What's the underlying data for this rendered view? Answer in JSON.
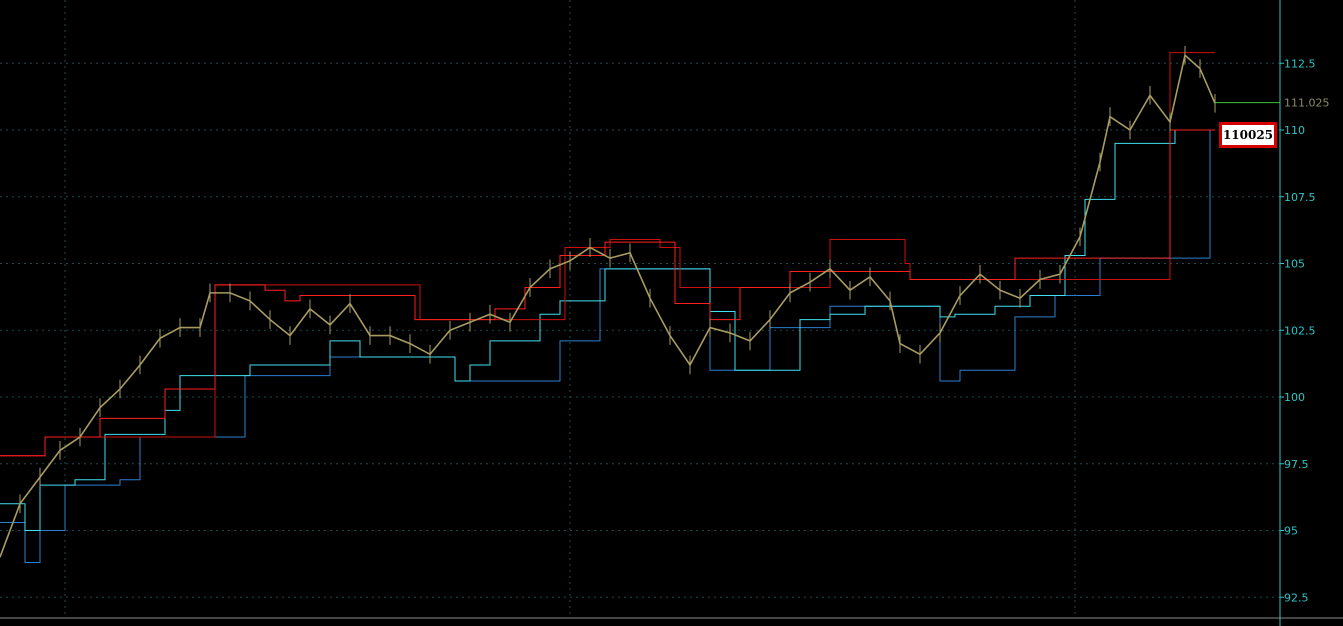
{
  "colors": {
    "background": "#000000",
    "grid": "#1f4a4a",
    "axis": "#2ec4c4",
    "tick_text": "#2ec4c4",
    "price": "#a89c62",
    "channel_upper_fast": "#ff2020",
    "channel_upper_slow": "#cc1010",
    "channel_lower_fast": "#40e0f0",
    "channel_lower_slow": "#2a7fd0",
    "last_price_line": "#3cc43c",
    "last_price_text": "#8a8a66"
  },
  "chart_data": {
    "type": "line",
    "ylim": [
      92.0,
      113.5
    ],
    "xlim": [
      0,
      1215
    ],
    "y_ticks": [
      "92.5",
      "95",
      "97.5",
      "100",
      "102.5",
      "105",
      "107.5",
      "110",
      "112.5"
    ],
    "grid": true,
    "last_price_label": "111.025",
    "price_box_label": "110025",
    "series": [
      {
        "role": "price",
        "x": [
          0,
          20,
          40,
          60,
          80,
          100,
          120,
          140,
          160,
          180,
          200,
          210,
          230,
          250,
          270,
          290,
          310,
          330,
          350,
          370,
          390,
          410,
          430,
          450,
          470,
          490,
          510,
          530,
          550,
          570,
          590,
          610,
          630,
          650,
          670,
          690,
          710,
          730,
          750,
          770,
          790,
          810,
          830,
          850,
          870,
          890,
          900,
          920,
          940,
          960,
          980,
          1000,
          1020,
          1040,
          1060,
          1080,
          1100,
          1110,
          1130,
          1150,
          1170,
          1185,
          1200,
          1215
        ],
        "y": [
          94.0,
          96.0,
          97.0,
          98.0,
          98.5,
          99.6,
          100.3,
          101.2,
          102.2,
          102.6,
          102.6,
          103.9,
          103.9,
          103.6,
          102.9,
          102.3,
          103.3,
          102.7,
          103.5,
          102.3,
          102.3,
          102.0,
          101.6,
          102.5,
          102.8,
          103.1,
          102.8,
          104.1,
          104.8,
          105.1,
          105.6,
          105.2,
          105.4,
          103.7,
          102.3,
          101.2,
          102.6,
          102.4,
          102.1,
          102.9,
          103.9,
          104.3,
          104.8,
          104.0,
          104.5,
          103.6,
          102.0,
          101.6,
          102.4,
          103.8,
          104.6,
          104.0,
          103.7,
          104.4,
          104.6,
          106.0,
          108.8,
          110.5,
          110.0,
          111.3,
          110.3,
          112.8,
          112.3,
          111.0
        ]
      },
      {
        "role": "channel-upper-fast",
        "x": [
          0,
          45,
          45,
          100,
          100,
          165,
          165,
          215,
          215,
          265,
          265,
          285,
          285,
          300,
          300,
          340,
          340,
          415,
          415,
          495,
          495,
          525,
          525,
          560,
          560,
          605,
          605,
          675,
          675,
          710,
          710,
          740,
          740,
          790,
          790,
          830,
          830,
          905,
          905,
          910,
          910,
          990,
          990,
          1015,
          1015,
          1060,
          1060,
          1100,
          1100,
          1140,
          1140,
          1170,
          1170,
          1215
        ],
        "y": [
          97.8,
          97.8,
          98.5,
          98.5,
          99.2,
          99.2,
          100.3,
          100.3,
          104.2,
          104.2,
          104.0,
          104.0,
          103.6,
          103.6,
          103.8,
          103.8,
          103.8,
          103.8,
          102.9,
          102.9,
          103.3,
          103.3,
          104.1,
          104.1,
          105.3,
          105.3,
          105.8,
          105.8,
          103.5,
          103.5,
          102.9,
          102.9,
          104.1,
          104.1,
          104.7,
          104.7,
          104.7,
          104.7,
          104.7,
          104.7,
          104.4,
          104.4,
          104.4,
          104.4,
          105.2,
          105.2,
          105.2,
          105.2,
          105.2,
          105.2,
          105.2,
          105.2,
          110.0,
          110.0
        ]
      },
      {
        "role": "channel-upper-slow",
        "x": [
          0,
          45,
          45,
          215,
          215,
          420,
          420,
          565,
          565,
          610,
          610,
          660,
          660,
          680,
          680,
          830,
          830,
          905,
          905,
          910,
          910,
          1170,
          1170,
          1215
        ],
        "y": [
          97.8,
          97.8,
          98.5,
          98.5,
          104.2,
          104.2,
          102.9,
          102.9,
          105.6,
          105.6,
          105.9,
          105.9,
          105.6,
          105.6,
          104.1,
          104.1,
          105.9,
          105.9,
          105.0,
          105.0,
          104.4,
          104.4,
          112.9,
          112.9
        ]
      },
      {
        "role": "channel-lower-fast",
        "x": [
          0,
          25,
          25,
          40,
          40,
          75,
          75,
          105,
          105,
          165,
          165,
          180,
          180,
          250,
          250,
          280,
          280,
          330,
          330,
          360,
          360,
          455,
          455,
          470,
          470,
          490,
          490,
          540,
          540,
          560,
          560,
          605,
          605,
          710,
          710,
          735,
          735,
          800,
          800,
          830,
          830,
          865,
          865,
          940,
          940,
          955,
          955,
          995,
          995,
          1030,
          1030,
          1065,
          1065,
          1085,
          1085,
          1115,
          1115,
          1175,
          1175,
          1215
        ],
        "y": [
          96.0,
          96.0,
          95.0,
          95.0,
          96.7,
          96.7,
          96.9,
          96.9,
          98.6,
          98.6,
          99.5,
          99.5,
          100.8,
          100.8,
          101.2,
          101.2,
          101.2,
          101.2,
          102.1,
          102.1,
          101.5,
          101.5,
          100.6,
          100.6,
          101.2,
          101.2,
          102.1,
          102.1,
          103.1,
          103.1,
          103.6,
          103.6,
          104.8,
          104.8,
          103.2,
          103.2,
          101.0,
          101.0,
          102.9,
          102.9,
          103.1,
          103.1,
          103.4,
          103.4,
          103.0,
          103.0,
          103.1,
          103.1,
          103.4,
          103.4,
          103.8,
          103.8,
          105.3,
          105.3,
          107.4,
          107.4,
          109.5,
          109.5,
          110.0,
          110.0
        ]
      },
      {
        "role": "channel-lower-slow",
        "x": [
          0,
          25,
          25,
          40,
          40,
          65,
          65,
          120,
          120,
          140,
          140,
          245,
          245,
          330,
          330,
          455,
          455,
          560,
          560,
          600,
          600,
          710,
          710,
          770,
          770,
          830,
          830,
          940,
          940,
          960,
          960,
          1015,
          1015,
          1055,
          1055,
          1100,
          1100,
          1210,
          1210,
          1215
        ],
        "y": [
          95.3,
          95.3,
          93.8,
          93.8,
          95.0,
          95.0,
          96.7,
          96.7,
          96.9,
          96.9,
          98.5,
          98.5,
          100.8,
          100.8,
          101.5,
          101.5,
          100.6,
          100.6,
          102.1,
          102.1,
          104.8,
          104.8,
          101.0,
          101.0,
          102.6,
          102.6,
          103.4,
          103.4,
          100.6,
          100.6,
          101.0,
          101.0,
          103.0,
          103.0,
          103.8,
          103.8,
          105.2,
          105.2,
          110.0,
          110.0
        ]
      }
    ]
  }
}
